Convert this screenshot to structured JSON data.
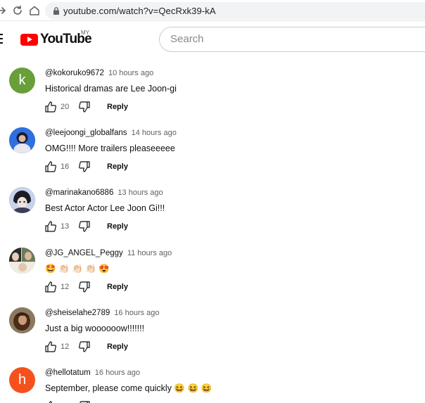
{
  "browser": {
    "url": "youtube.com/watch?v=QecRxk39-kA"
  },
  "header": {
    "logo_text": "YouTube",
    "region": "MY",
    "search_placeholder": "Search"
  },
  "colors": {
    "brand_red": "#ff0000",
    "secondary_text": "#606060"
  },
  "comments": [
    {
      "author": "@kokoruko9672",
      "time": "10 hours ago",
      "text": "Historical dramas are Lee Joon-gi",
      "likes": "20",
      "reply_label": "Reply",
      "avatar_letter": "k",
      "avatar_color": "#689f38"
    },
    {
      "author": "@leejoongi_globalfans",
      "time": "14 hours ago",
      "text": "OMG!!!! More trailers pleaseeeee",
      "likes": "16",
      "reply_label": "Reply",
      "avatar_letter": "",
      "avatar_color": "#1f62d8"
    },
    {
      "author": "@marinakano6886",
      "time": "13 hours ago",
      "text": "Best Actor Actor Lee Joon Gi!!!",
      "likes": "13",
      "reply_label": "Reply",
      "avatar_letter": "",
      "avatar_color": "#3a4a7a"
    },
    {
      "author": "@JG_ANGEL_Peggy",
      "time": "11 hours ago",
      "text": "🤩 👏🏻 👏🏻 👏🏻 😍",
      "likes": "12",
      "reply_label": "Reply",
      "avatar_letter": "",
      "avatar_color": "#2a2a2a"
    },
    {
      "author": "@sheiselahe2789",
      "time": "16 hours ago",
      "text": "Just a big woooooow!!!!!!!",
      "likes": "12",
      "reply_label": "Reply",
      "avatar_letter": "",
      "avatar_color": "#5a3a24"
    },
    {
      "author": "@hellotatum",
      "time": "16 hours ago",
      "text": "September, please come quickly 😆 😆 😆",
      "likes": "",
      "reply_label": "Reply",
      "avatar_letter": "h",
      "avatar_color": "#f4511e"
    }
  ]
}
